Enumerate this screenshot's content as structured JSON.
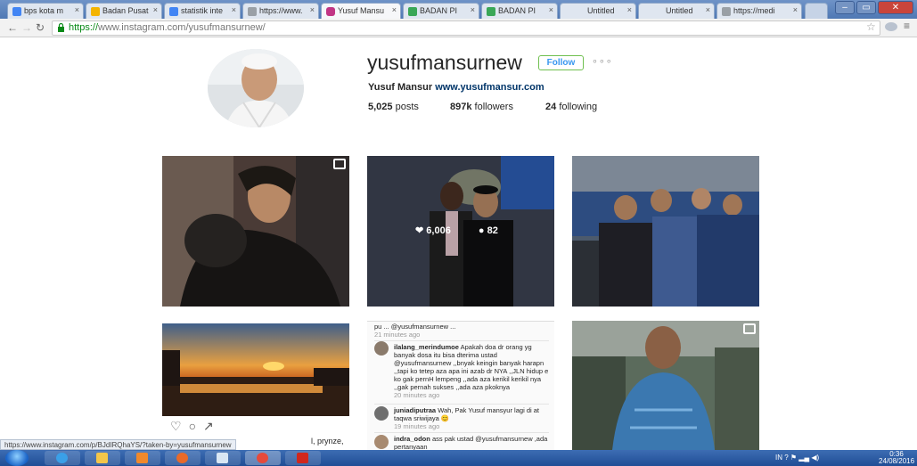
{
  "browser": {
    "tabs": [
      {
        "label": "bps kota m",
        "favicon_color": "#4285f4",
        "icon": "google-icon"
      },
      {
        "label": "Badan Pusat",
        "favicon_color": "#f4b400",
        "icon": "bps-icon"
      },
      {
        "label": "statistik inte",
        "favicon_color": "#4285f4",
        "icon": "google-icon"
      },
      {
        "label": "https://www.",
        "favicon_color": "#9aa0a6",
        "icon": "page-icon"
      },
      {
        "label": "Yusuf Mansu",
        "favicon_color": "#c13584",
        "icon": "instagram-icon"
      },
      {
        "label": "BADAN PI",
        "favicon_color": "#3aa757",
        "icon": "bps-icon"
      },
      {
        "label": "BADAN PI",
        "favicon_color": "#3aa757",
        "icon": "bps-icon"
      },
      {
        "label": "Untitled",
        "favicon_color": "",
        "icon": ""
      },
      {
        "label": "Untitled",
        "favicon_color": "",
        "icon": ""
      },
      {
        "label": "https://medi",
        "favicon_color": "#9aa0a6",
        "icon": "page-icon"
      }
    ],
    "url_scheme": "https://",
    "url_rest": "www.instagram.com/yusufmansurnew/"
  },
  "profile": {
    "username": "yusufmansurnew",
    "follow_label": "Follow",
    "more_label": "∘∘∘",
    "full_name": "Yusuf Mansur",
    "website": "www.yusufmansur.com",
    "posts_count": "5,025",
    "posts_label": "posts",
    "followers_count": "897k",
    "followers_label": "followers",
    "following_count": "24",
    "following_label": "following"
  },
  "posts": [
    {
      "alt": "post-hug"
    },
    {
      "alt": "post-portrait",
      "likes": "6,006",
      "comments": "82"
    },
    {
      "alt": "post-audience"
    },
    {
      "alt": "post-sunset"
    },
    {
      "alt": "post-comments"
    },
    {
      "alt": "post-man-batik"
    }
  ],
  "comments": {
    "top_fragment": "pu ... @yusufmansurnew ...",
    "top_time": "21 minutes ago",
    "items": [
      {
        "name": "ilalang_merindumoe",
        "text": "Apakah doa dr orang yg banyak dosa itu bisa dterima ustad @yusufmansurnew ,,bnyak keingin banyak harapn ,,tapi ko tetep aza apa ini azab dr NYA ,,JLN hidup e ko gak pernH lempeng ,,ada aza kerikil kerikil nya ,,gak pernah sukses ,,ada aza pkoknya",
        "time": "20 minutes ago"
      },
      {
        "name": "juniadiputraa",
        "text": "Wah, Pak Yusuf mansyur lagi di at taqwa sriwijaya 😊",
        "time": "19 minutes ago"
      },
      {
        "name": "indra_odon",
        "text": "ass pak ustad @yusufmansurnew ,ada pertanyaan",
        "time": ""
      }
    ]
  },
  "caption_fragment": "l, prynze,",
  "statusbar_url": "https://www.instagram.com/p/BJdIRQhaYS/?taken-by=yusufmansurnew",
  "tray": {
    "lang": "IN",
    "clock_time": "0:36",
    "clock_date": "24/08/2016"
  },
  "colors": {
    "accent": "#3897f0",
    "follow_border": "#70c050",
    "titlebar": "#4f78b4"
  }
}
